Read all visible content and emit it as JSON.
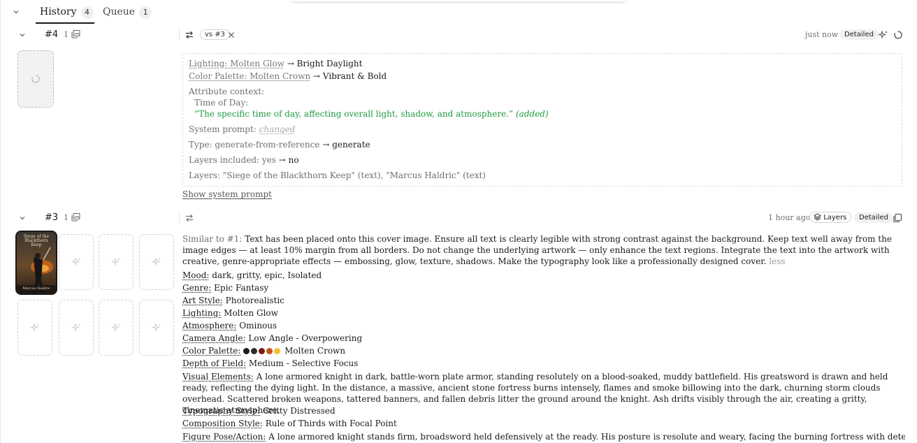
{
  "tabs": [
    {
      "label": "History",
      "count": "4",
      "active": true
    },
    {
      "label": "Queue",
      "count": "1",
      "active": false
    }
  ],
  "entry4": {
    "number": "#4",
    "image_count": "1",
    "compare_label": "vs #3",
    "time": "just now",
    "detailed_label": "Detailed",
    "diff": {
      "lighting_key": "Lighting: Molten Glow",
      "lighting_new": "Bright Daylight",
      "palette_key": "Color Palette: Molten Crown",
      "palette_new": "Vibrant & Bold",
      "attr_context_label": "Attribute context:",
      "time_of_day_label": "Time of Day:",
      "time_of_day_text": "“The specific time of day, affecting overall light, shadow, and atmosphere.”",
      "time_of_day_note": "(added)",
      "system_prompt_label": "System prompt:",
      "system_prompt_value": "changed",
      "type_label": "Type: generate-from-reference",
      "type_new": "generate",
      "layers_included_label": "Layers included: yes",
      "layers_included_new": "no",
      "layers_text": "Layers: \"Siege of the Blackthorn Keep\" (text), \"Marcus Haldric\" (text)"
    },
    "show_system_prompt": "Show system prompt"
  },
  "entry3": {
    "number": "#3",
    "image_count": "1",
    "time": "1 hour ago",
    "layers_label": "Layers",
    "detailed_label": "Detailed",
    "similar_prefix": "Similar to #1:",
    "prompt_text": "Text has been placed onto this cover image. Ensure all text is clearly legible with strong contrast against the background. Keep text well away from the image edges — at least 10% margin from all borders. Do not change the underlying artwork — only enhance the text regions. Integrate the text into the artwork with creative, genre-appropriate effects — embossing, glow, texture, shadows. Make the typography look like a professionally designed cover.",
    "less_label": "less",
    "attributes": [
      {
        "key": "Mood:",
        "value": "dark, gritty, epic, Isolated"
      },
      {
        "key": "Genre:",
        "value": "Epic Fantasy"
      },
      {
        "key": "Art Style:",
        "value": "Photorealistic"
      },
      {
        "key": "Lighting:",
        "value": "Molten Glow"
      },
      {
        "key": "Atmosphere:",
        "value": "Ominous"
      },
      {
        "key": "Camera Angle:",
        "value": "Low Angle - Overpowering"
      },
      {
        "key": "Color Palette:",
        "value": "Molten Crown"
      },
      {
        "key": "Depth of Field:",
        "value": "Medium - Selective Focus"
      }
    ],
    "palette_colors": [
      "#1c1c1c",
      "#2d2d2d",
      "#7a1d12",
      "#c2551a",
      "#f2c12e"
    ],
    "visual_key": "Visual Elements:",
    "visual_value": "A lone armored knight in dark, battle-worn plate armor, standing resolutely on a blood-soaked, muddy battlefield. His greatsword is drawn and held ready, reflecting the dying light. In the distance, a massive, ancient stone fortress burns intensely, flames and smoke billowing into the dark, churning storm clouds overhead. Scattered broken weapons, tattered banners, and fallen debris litter the ground around the knight. Ash drifts visibly through the air, creating a gritty, cinematic atmosphere.",
    "typography_key": "Typography Style:",
    "typography_value": "Gritty Distressed",
    "composition_key": "Composition Style:",
    "composition_value": "Rule of Thirds with Focal Point",
    "figure_key": "Figure Pose/Action:",
    "figure_value": "A lone armored knight stands firm, broadsword held defensively at the ready. His posture is resolute and weary, facing the burning fortress with determination. The knight's helmet obscures his",
    "cover_title": "Siege of the Blackthorn Keep",
    "cover_author": "Marcus Haldric"
  }
}
